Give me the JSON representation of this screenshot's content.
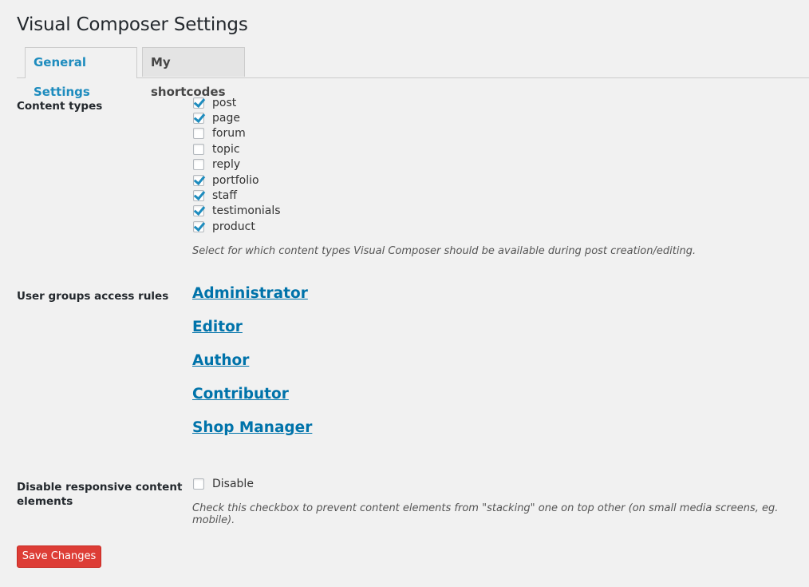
{
  "page": {
    "title": "Visual Composer Settings"
  },
  "tabs": [
    {
      "label": "General Settings",
      "active": true
    },
    {
      "label": "My shortcodes",
      "active": false
    }
  ],
  "content_types": {
    "label": "Content types",
    "items": [
      {
        "label": "post",
        "checked": true
      },
      {
        "label": "page",
        "checked": true
      },
      {
        "label": "forum",
        "checked": false
      },
      {
        "label": "topic",
        "checked": false
      },
      {
        "label": "reply",
        "checked": false
      },
      {
        "label": "portfolio",
        "checked": true
      },
      {
        "label": "staff",
        "checked": true
      },
      {
        "label": "testimonials",
        "checked": true
      },
      {
        "label": "product",
        "checked": true
      }
    ],
    "hint": "Select for which content types Visual Composer should be available during post creation/editing."
  },
  "user_groups": {
    "label": "User groups access rules",
    "links": [
      "Administrator",
      "Editor",
      "Author",
      "Contributor",
      "Shop Manager"
    ]
  },
  "responsive": {
    "label_line1": "Disable responsive content",
    "label_line2": "elements",
    "checkbox_label": "Disable",
    "checked": false,
    "hint": "Check this checkbox to prevent content elements from \"stacking\" one on top other (on small media screens, eg. mobile)."
  },
  "actions": {
    "save_label": "Save Changes"
  },
  "colors": {
    "accent": "#1e8cbe",
    "link": "#0073aa",
    "save_button": "#dd3d36"
  }
}
